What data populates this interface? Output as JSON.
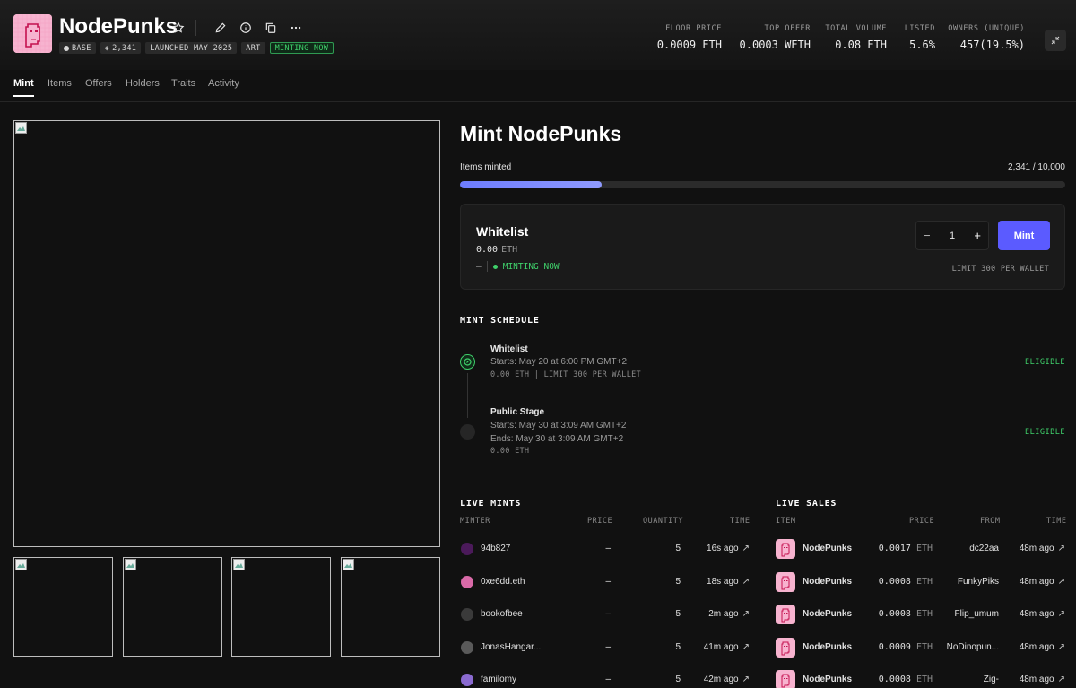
{
  "collection": {
    "name": "NodePunks",
    "badges": [
      {
        "label": "BASE",
        "icon": "base-chain-icon"
      },
      {
        "label": "2,341",
        "icon": "layers-icon"
      },
      {
        "label": "LAUNCHED MAY 2025"
      },
      {
        "label": "ART"
      },
      {
        "label": "MINTING NOW",
        "color": "#3fcf6a"
      }
    ]
  },
  "stats": [
    {
      "label": "FLOOR PRICE",
      "value": "0.0009 ETH"
    },
    {
      "label": "TOP OFFER",
      "value": "0.0003 WETH"
    },
    {
      "label": "TOTAL VOLUME",
      "value": "0.08 ETH"
    },
    {
      "label": "LISTED",
      "value": "5.6%"
    },
    {
      "label": "OWNERS (UNIQUE)",
      "value": "457(19.5%)"
    }
  ],
  "tabs": [
    "Mint",
    "Items",
    "Offers",
    "Holders",
    "Traits",
    "Activity"
  ],
  "active_tab": "Mint",
  "mint": {
    "title": "Mint NodePunks",
    "items_minted_label": "Items minted",
    "items_minted_value": "2,341 / 10,000",
    "progress_fraction": 0.2341,
    "accent": "#5b5bff",
    "stage_card": {
      "name": "Whitelist",
      "price": "0.00",
      "unit": "ETH",
      "dash": "–",
      "status": "MINTING NOW",
      "quantity": "1",
      "minus": "−",
      "plus": "+",
      "button": "Mint",
      "limit": "LIMIT 300 PER WALLET"
    }
  },
  "schedule": {
    "heading": "MINT SCHEDULE",
    "stages": [
      {
        "name": "Whitelist",
        "line1": "Starts: May 20 at 6:00 PM GMT+2",
        "line2": "",
        "meta": "0.00 ETH | LIMIT 300 PER WALLET",
        "status": "ELIGIBLE"
      },
      {
        "name": "Public Stage",
        "line1": "Starts: May 30 at 3:09 AM GMT+2",
        "line2": "Ends: May 30 at 3:09 AM GMT+2",
        "meta": "0.00 ETH",
        "status": "ELIGIBLE"
      }
    ]
  },
  "live_mints": {
    "heading": "LIVE MINTS",
    "columns": [
      "MINTER",
      "PRICE",
      "QUANTITY",
      "TIME"
    ],
    "rows": [
      {
        "minter": "94b827",
        "price": "–",
        "quantity": "5",
        "time": "16s ago"
      },
      {
        "minter": "0xe6dd.eth",
        "price": "–",
        "quantity": "5",
        "time": "18s ago"
      },
      {
        "minter": "bookofbee",
        "price": "–",
        "quantity": "5",
        "time": "2m ago"
      },
      {
        "minter": "JonasHangar...",
        "price": "–",
        "quantity": "5",
        "time": "41m ago"
      },
      {
        "minter": "familomy",
        "price": "–",
        "quantity": "5",
        "time": "42m ago"
      }
    ]
  },
  "live_sales": {
    "heading": "LIVE SALES",
    "columns": [
      "ITEM",
      "PRICE",
      "FROM",
      "TIME"
    ],
    "rows": [
      {
        "item": "NodePunks",
        "price": "0.0017",
        "unit": "ETH",
        "from": "dc22aa",
        "time": "48m ago"
      },
      {
        "item": "NodePunks",
        "price": "0.0008",
        "unit": "ETH",
        "from": "FunkyPiks",
        "time": "48m ago"
      },
      {
        "item": "NodePunks",
        "price": "0.0008",
        "unit": "ETH",
        "from": "Flip_umum",
        "time": "48m ago"
      },
      {
        "item": "NodePunks",
        "price": "0.0009",
        "unit": "ETH",
        "from": "NoDinopun...",
        "time": "48m ago"
      },
      {
        "item": "NodePunks",
        "price": "0.0008",
        "unit": "ETH",
        "from": "Zig-",
        "time": "48m ago"
      }
    ]
  },
  "arrow_glyph": "↗"
}
